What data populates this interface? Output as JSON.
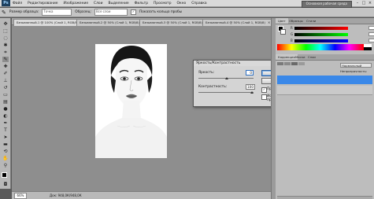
{
  "menubar": {
    "logo": "Ps",
    "items": [
      "Файл",
      "Редактирование",
      "Изображение",
      "Слои",
      "Выделение",
      "Фильтр",
      "Просмотр",
      "Окно",
      "Справка"
    ],
    "essentials": "Основная рабочая среда",
    "controls": [
      "–",
      "□",
      "×"
    ]
  },
  "options": {
    "sample_size_label": "Размер образца:",
    "sample_size_value": "Точка",
    "sample_label": "Образец:",
    "sample_value": "Все слои",
    "show_ring_label": "Показать кольцо пробы"
  },
  "tabs": [
    {
      "label": "Безымянный-1 @ 100% (Слой 1, RGB/8)"
    },
    {
      "label": "Безымянный-2 @ 50% (Слой 1, RGB/8)"
    },
    {
      "label": "Безымянный-3 @ 50% (Слой 1, RGB/8)"
    },
    {
      "label": "Безымянный-4 @ 50% (Слой 1, RGB/8)"
    }
  ],
  "statusbar": {
    "zoom": "66%",
    "doc": "Док: 948,0К/948,0К"
  },
  "dialog": {
    "title": "Яркость/Контрастность",
    "brightness_label": "Яркость:",
    "brightness_value": "0",
    "contrast_label": "Контрастность:",
    "contrast_value": "100",
    "ok": "OK",
    "cancel": "Отмена",
    "preview_label": "Просмотр",
    "legacy_label": "Использовать прежние",
    "close": "×"
  },
  "panels": {
    "color_tabs": [
      "Цвет",
      "Образцы",
      "Стили"
    ],
    "channels": [
      "R",
      "G",
      "B"
    ],
    "adjust_tabs": [
      "Коррекция",
      "Маски",
      "Слои"
    ],
    "blend_mode": "Нормальный",
    "opacity_label": "Непрозрачность:"
  },
  "colors": {
    "accent": "#2e6fc0",
    "layer_selected": "#3a88e8"
  }
}
